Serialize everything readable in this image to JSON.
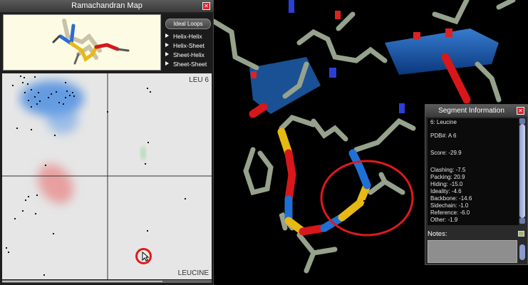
{
  "ramachandran": {
    "title": "Ramachandran Map",
    "ideal_loops_button": "Ideal Loops",
    "loop_types": [
      "Helix-Helix",
      "Helix-Sheet",
      "Sheet-Helix",
      "Sheet-Sheet"
    ],
    "residue_label": "LEU 6",
    "residue_name": "LEUCINE"
  },
  "segment": {
    "title": "Segment Information",
    "header": "6: Leucine",
    "pdb": "PDB#: A 6",
    "score": "Score: -29.9",
    "lines": [
      "Clashing: -7.5",
      "Packing: 20.9",
      "Hiding: -15.0",
      "Ideality: -4.6",
      "Backbone: -14.6",
      "Sidechain: -1.0",
      "Reference: -6.0",
      "Other: -1.9"
    ],
    "notes_label": "Notes:"
  },
  "colors": {
    "highlight_circle": "#e0191c",
    "helix_blue": "#1f6fd6",
    "loop_yellow": "#e7b915",
    "loop_red": "#d8171a",
    "sidechain": "#9aa590"
  },
  "icons": [
    "close-icon",
    "play-triangle-icon",
    "cursor-icon",
    "notes-icon"
  ]
}
